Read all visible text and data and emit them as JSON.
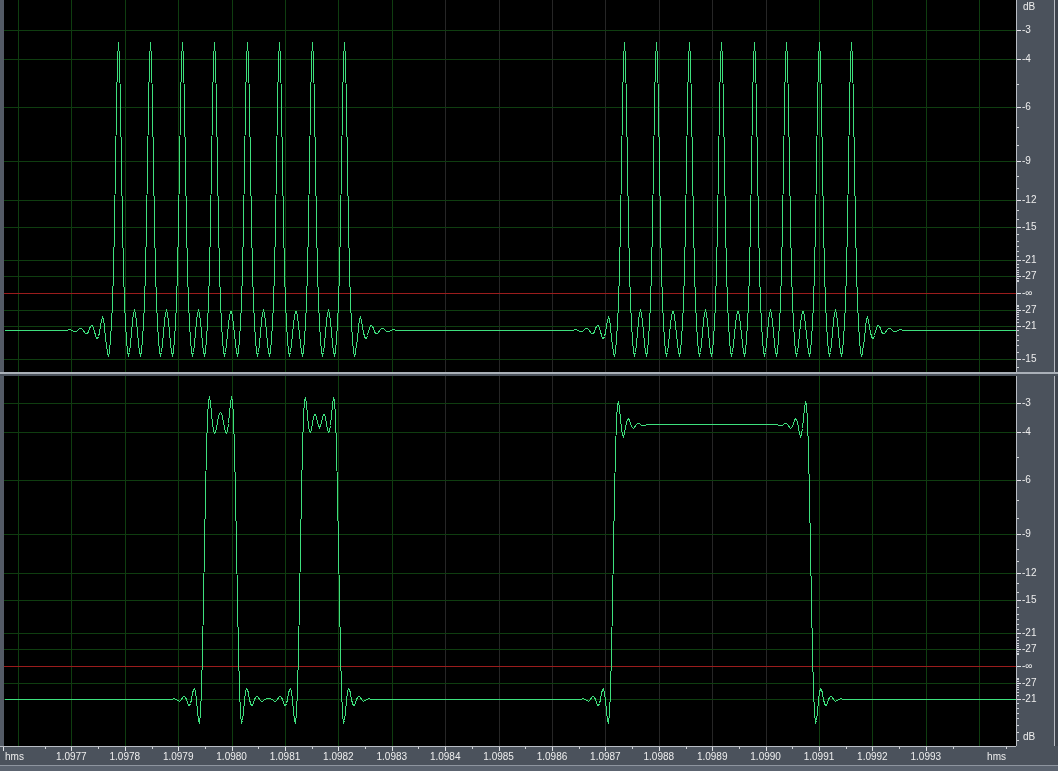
{
  "channels": [
    {
      "scale_top_label": "dB",
      "scale_labels": [
        "-3",
        "-4",
        "-6",
        "-9",
        "-12",
        "-15",
        "-21",
        "-27",
        "-∞",
        "-27",
        "-21",
        "-15"
      ]
    },
    {
      "scale_labels": [
        "-3",
        "-4",
        "-6",
        "-9",
        "-12",
        "-15",
        "-21",
        "-27",
        "-∞",
        "-27",
        "-21"
      ],
      "scale_bottom_label": "dB"
    }
  ],
  "time_ruler": {
    "start_unit": "hms",
    "labels": [
      "1.0977",
      "1.0978",
      "1.0979",
      "1.0980",
      "1.0981",
      "1.0982",
      "1.0983",
      "1.0984",
      "1.0985",
      "1.0986",
      "1.0987",
      "1.0988",
      "1.0989",
      "1.0990",
      "1.0991",
      "1.0992",
      "1.0993"
    ],
    "end_unit": "hms"
  }
}
